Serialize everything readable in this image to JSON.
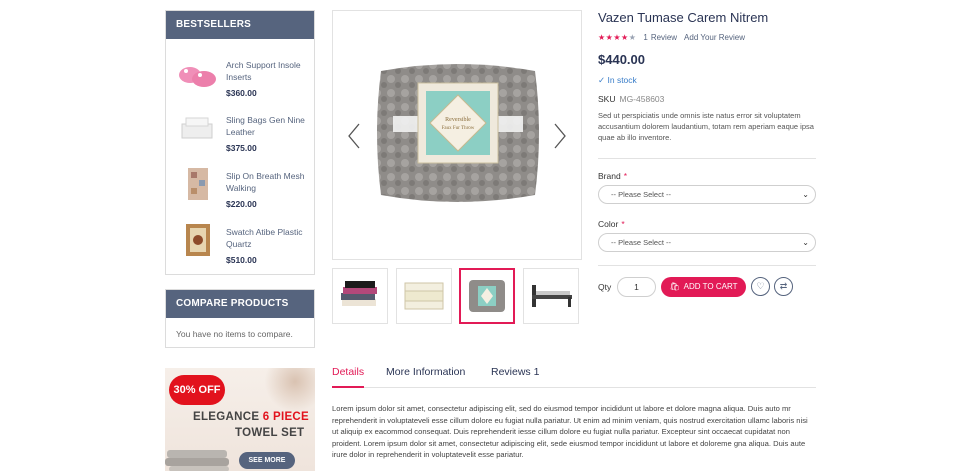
{
  "sidebar": {
    "bestsellers": {
      "title": "BESTSELLERS",
      "items": [
        {
          "name": "Arch Support Insole Inserts",
          "price": "$360.00",
          "icon": "slippers-icon"
        },
        {
          "name": "Sling Bags Gen Nine Leather",
          "price": "$375.00",
          "icon": "towels-icon"
        },
        {
          "name": "Slip On Breath Mesh Walking",
          "price": "$220.00",
          "icon": "rug-icon"
        },
        {
          "name": "Swatch Atibe Plastic Quartz",
          "price": "$510.00",
          "icon": "carpet-icon"
        }
      ]
    },
    "compare": {
      "title": "COMPARE PRODUCTS",
      "empty_text": "You have no items to compare."
    },
    "banner": {
      "discount": "30% OFF",
      "line1_a": "ELEGANCE ",
      "line1_b": "6 PIECE",
      "line2": "TOWEL SET",
      "button": "SEE MORE"
    }
  },
  "product": {
    "title": "Vazen Tumase Carem Nitrem",
    "rating_value": 4,
    "rating_max": 5,
    "review_count": "1",
    "review_label": "Review",
    "add_review": "Add Your Review",
    "price": "$440.00",
    "stock": "In stock",
    "sku_label": "SKU",
    "sku": "MG-458603",
    "description": "Sed ut perspiciatis unde omnis iste natus error sit voluptatem accusantium dolorem laudantium, totam rem aperiam eaque ipsa quae ab illo inventore.",
    "options": [
      {
        "label": "Brand",
        "required": "*",
        "placeholder": "-- Please Select --"
      },
      {
        "label": "Color",
        "required": "*",
        "placeholder": "-- Please Select --"
      }
    ],
    "qty_label": "Qty",
    "qty_value": "1",
    "add_to_cart": "ADD TO CART",
    "image_label_l1": "Reversible",
    "image_label_l2": "Faux Fur Throw",
    "thumbnails": [
      "sheets-thumbnail",
      "mattress-thumbnail",
      "throw-blanket-thumbnail",
      "bed-frame-thumbnail"
    ],
    "active_thumbnail": 2
  },
  "tabs": {
    "items": [
      "Details",
      "More Information",
      "Reviews 1"
    ],
    "active": 0,
    "body": "Lorem ipsum dolor sit amet, consectetur adipiscing elit, sed do eiusmod tempor incididunt ut labore et dolore magna aliqua. Duis auto mr reprehenderit in voluptateveli esse cillum dolore eu fugiat nulla pariatur. Ut enim ad minim veniam, quis nostrud exercitation ullamc laboris nisi ut aliquip ex eacommod consequat. Duis reprehenderit iesse cillum dolore eu fugiat nulla pariatur. Excepteur sint occaecat cupidatat non proident. Lorem ipsum dolor sit amet, consectetur adipiscing elit, sede eiusmod tempor incididunt ut labore et doloreme gna aliqua. Duis aute irure dolor in reprehenderit in voluptatevelit esse pariatur."
  },
  "colors": {
    "accent": "#e21a56",
    "header": "#56647e",
    "navy": "#2a3454",
    "in_stock": "#3a7ec9"
  }
}
